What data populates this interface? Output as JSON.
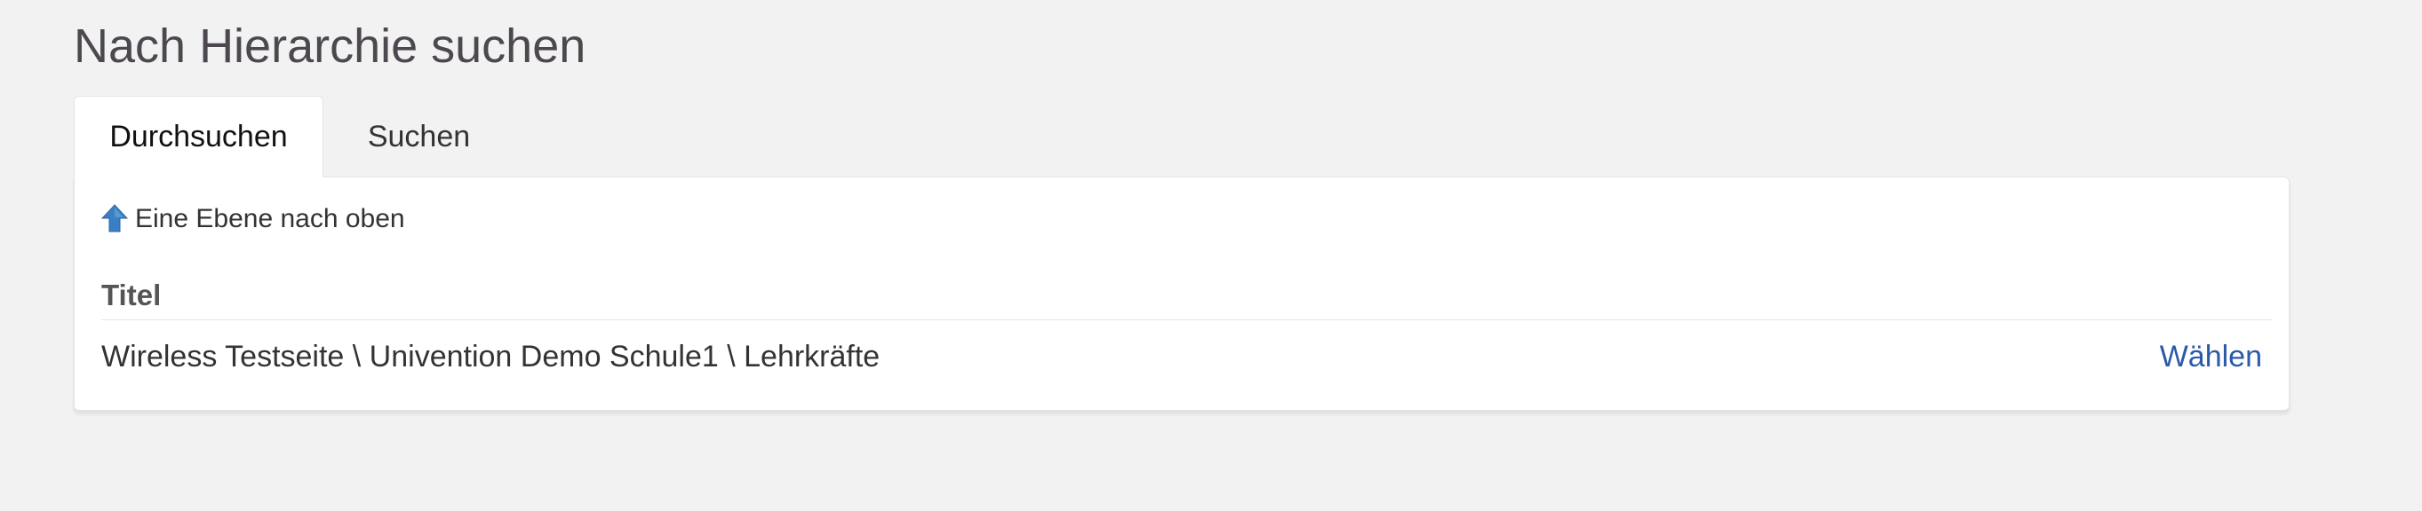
{
  "page": {
    "title": "Nach Hierarchie suchen"
  },
  "tabs": [
    {
      "label": "Durchsuchen",
      "active": true
    },
    {
      "label": "Suchen",
      "active": false
    }
  ],
  "browse": {
    "up_link": {
      "icon": "arrow-up-icon",
      "label": "Eine Ebene nach oben"
    },
    "columns": {
      "title": "Titel"
    },
    "rows": [
      {
        "path": "Wireless Testseite \\ Univention Demo Schule1 \\ Lehrkräfte",
        "action": "Wählen"
      }
    ]
  },
  "colors": {
    "background": "#f2f2f2",
    "panel": "#ffffff",
    "title_text": "#4d484f",
    "link": "#2a5aa8",
    "icon": "#3a7fc4"
  }
}
